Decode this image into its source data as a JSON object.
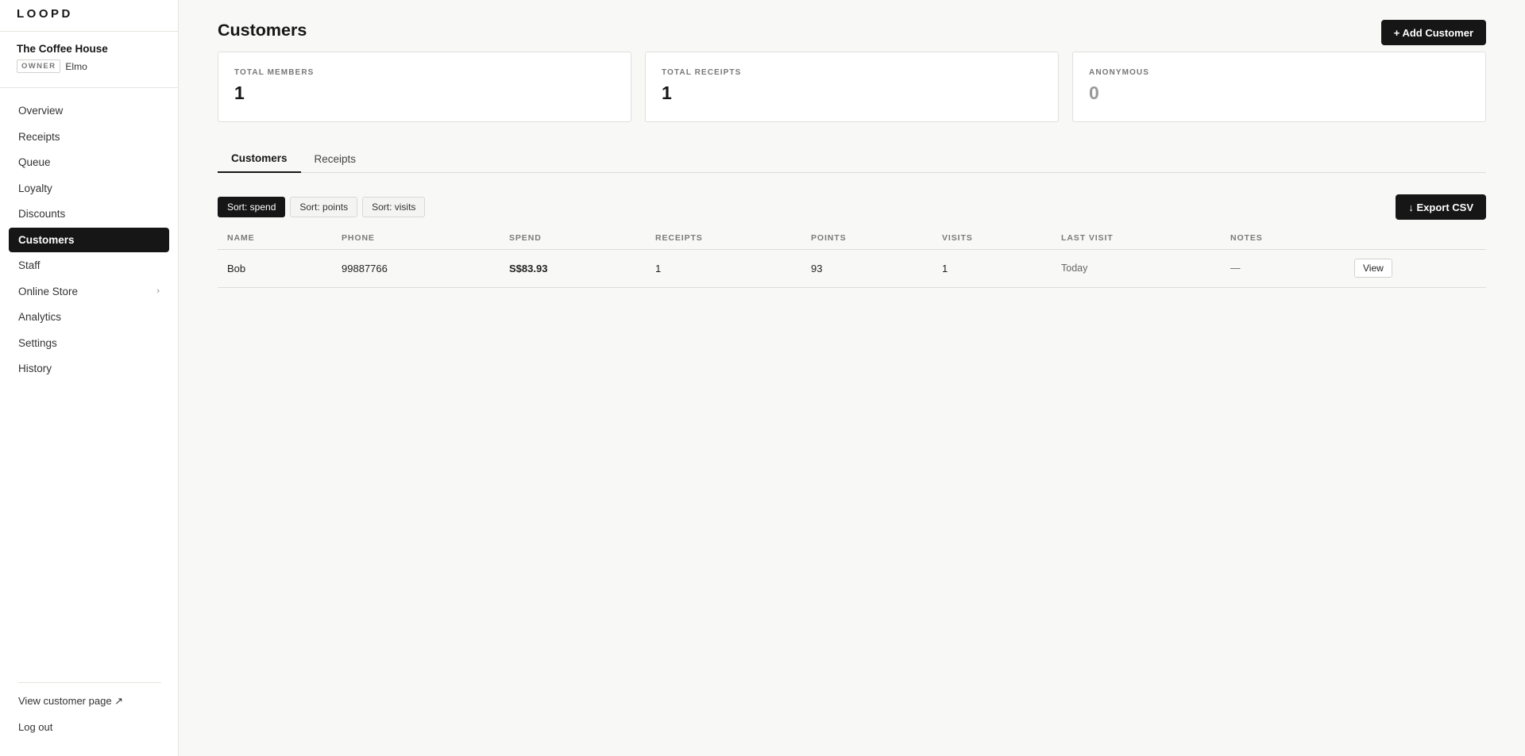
{
  "brand": {
    "name": "LOOPD"
  },
  "store": {
    "name": "The Coffee House",
    "role": "OWNER",
    "user": "Elmo"
  },
  "sidebar": {
    "items": [
      {
        "label": "Overview"
      },
      {
        "label": "Receipts"
      },
      {
        "label": "Queue"
      },
      {
        "label": "Loyalty"
      },
      {
        "label": "Discounts"
      },
      {
        "label": "Customers",
        "active": true
      },
      {
        "label": "Staff"
      },
      {
        "label": "Online Store",
        "chevron": "›"
      },
      {
        "label": "Analytics"
      },
      {
        "label": "Settings"
      },
      {
        "label": "History"
      }
    ],
    "footer": {
      "view_customer_page": "View customer page ↗",
      "logout": "Log out"
    }
  },
  "header": {
    "title": "Customers",
    "add_button": "+ Add Customer"
  },
  "stats": [
    {
      "label": "TOTAL MEMBERS",
      "value": "1"
    },
    {
      "label": "TOTAL RECEIPTS",
      "value": "1"
    },
    {
      "label": "ANONYMOUS",
      "value": "0"
    }
  ],
  "tabs": [
    {
      "label": "Customers",
      "active": true
    },
    {
      "label": "Receipts"
    }
  ],
  "toolbar": {
    "sort_buttons": [
      {
        "label": "Sort: spend",
        "active": true
      },
      {
        "label": "Sort: points"
      },
      {
        "label": "Sort: visits"
      }
    ],
    "export_button": "↓ Export CSV"
  },
  "table": {
    "columns": [
      "NAME",
      "PHONE",
      "SPEND",
      "RECEIPTS",
      "POINTS",
      "VISITS",
      "LAST VISIT",
      "NOTES",
      ""
    ],
    "rows": [
      {
        "name": "Bob",
        "phone": "99887766",
        "spend": "S$83.93",
        "receipts": "1",
        "points": "93",
        "visits": "1",
        "last_visit": "Today",
        "notes": "—",
        "action": "View"
      }
    ]
  },
  "colors": {
    "accent": "#161616",
    "background": "#f8f8f6",
    "muted": "#999999"
  }
}
